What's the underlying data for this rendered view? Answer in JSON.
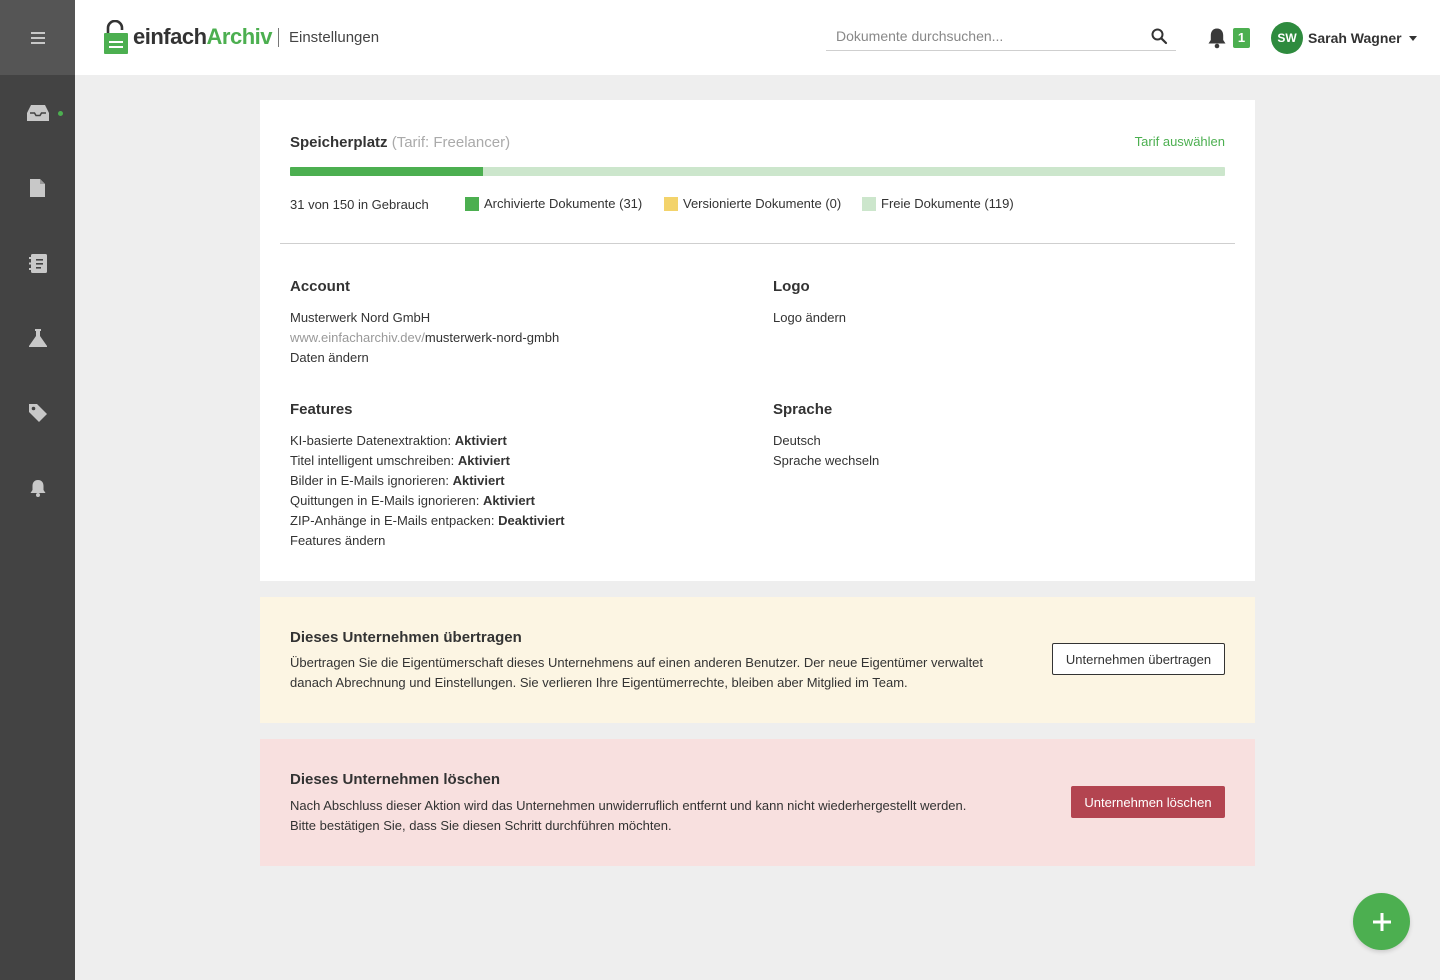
{
  "brand": {
    "name_part1": "einfach",
    "name_part2": "Archiv",
    "accent": "#4caf50"
  },
  "header": {
    "page_title": "Einstellungen",
    "search_placeholder": "Dokumente durchsuchen...",
    "notification_count": "1",
    "user": {
      "initials": "SW",
      "name": "Sarah Wagner"
    }
  },
  "sidebar": {
    "items": [
      {
        "icon": "inbox-icon",
        "active": true
      },
      {
        "icon": "document-icon"
      },
      {
        "icon": "address-book-icon"
      },
      {
        "icon": "flask-icon"
      },
      {
        "icon": "tag-icon"
      },
      {
        "icon": "bell-icon"
      }
    ]
  },
  "storage": {
    "title": "Speicherplatz",
    "plan": "(Tarif: Freelancer)",
    "choose_plan": "Tarif auswählen",
    "used": 31,
    "total": 150,
    "usage_text": "31 von 150 in Gebrauch",
    "legend": [
      {
        "label": "Archivierte Dokumente (31)",
        "color": "#4caf50"
      },
      {
        "label": "Versionierte Dokumente (0)",
        "color": "#f3d36b"
      },
      {
        "label": "Freie Dokumente (119)",
        "color": "#cce6cc"
      }
    ],
    "archived": 31,
    "versioned": 0,
    "free": 119
  },
  "account": {
    "heading": "Account",
    "company": "Musterwerk Nord GmbH",
    "url_prefix": "www.einfacharchiv.dev/",
    "url_slug": "musterwerk-nord-gmbh",
    "edit_link": "Daten ändern"
  },
  "logo_section": {
    "heading": "Logo",
    "edit_link": "Logo ändern"
  },
  "features": {
    "heading": "Features",
    "items": [
      {
        "label": "KI-basierte Datenextraktion:",
        "value": "Aktiviert"
      },
      {
        "label": "Titel intelligent umschreiben:",
        "value": "Aktiviert"
      },
      {
        "label": "Bilder in E-Mails ignorieren:",
        "value": "Aktiviert"
      },
      {
        "label": "Quittungen in E-Mails ignorieren:",
        "value": "Aktiviert"
      },
      {
        "label": "ZIP-Anhänge in E-Mails entpacken:",
        "value": "Deaktiviert"
      }
    ],
    "edit_link": "Features ändern"
  },
  "language": {
    "heading": "Sprache",
    "current": "Deutsch",
    "edit_link": "Sprache wechseln"
  },
  "transfer": {
    "title": "Dieses Unternehmen übertragen",
    "line1": "Übertragen Sie die Eigentümerschaft dieses Unternehmens auf einen anderen Benutzer. Der neue Eigentümer verwaltet",
    "line2": "danach Abrechnung und Einstellungen. Sie verlieren Ihre Eigentümerrechte, bleiben aber Mitglied im Team.",
    "button": "Unternehmen übertragen",
    "bg_color": "#fcf5e3"
  },
  "delete": {
    "title": "Dieses Unternehmen löschen",
    "line1": "Nach Abschluss dieser Aktion wird das Unternehmen unwiderruflich entfernt und kann nicht wiederhergestellt werden.",
    "line2": "Bitte bestätigen Sie, dass Sie diesen Schritt durchführen möchten.",
    "button": "Unternehmen löschen",
    "bg_color": "#f8e0df",
    "button_color": "#b34450"
  },
  "fab": {
    "icon": "plus-icon"
  }
}
